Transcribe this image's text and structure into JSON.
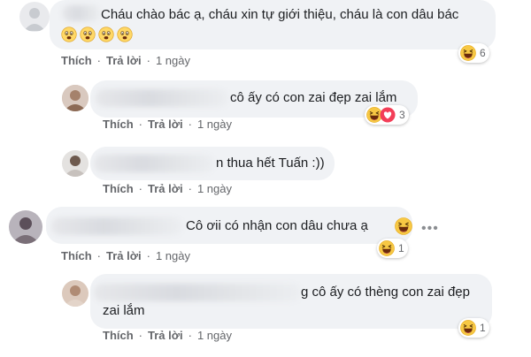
{
  "comments": [
    {
      "text": "Cháu chào bác ạ, cháu xin tự giới thiệu, cháu là con dâu bác",
      "emoji_row": [
        "frowning-face-emoji",
        "frowning-face-emoji",
        "frowning-face-emoji",
        "frowning-face-emoji"
      ],
      "actions": {
        "like": "Thích",
        "reply": "Trả lời",
        "time": "1 ngày"
      },
      "reaction": {
        "icons": [
          "haha-icon"
        ],
        "count": "6"
      }
    },
    {
      "text": "cô ấy có con zai đẹp zai lắm",
      "actions": {
        "like": "Thích",
        "reply": "Trả lời",
        "time": "1 ngày"
      },
      "reaction": {
        "icons": [
          "haha-icon",
          "love-icon"
        ],
        "count": "3"
      }
    },
    {
      "text": "n thua hết Tuấn :))",
      "actions": {
        "like": "Thích",
        "reply": "Trả lời",
        "time": "1 ngày"
      }
    },
    {
      "text": "Cô ơii có nhận con dâu chưa ạ",
      "inline_emoji": "laughing-emoji",
      "more_icon": "more-horizontal-icon",
      "actions": {
        "like": "Thích",
        "reply": "Trả lời",
        "time": "1 ngày"
      },
      "reaction": {
        "icons": [
          "haha-icon"
        ],
        "count": "1"
      }
    },
    {
      "text_line1": "g cô ấy có thèng con zai đẹp",
      "text_line2": "zai lắm",
      "actions": {
        "like": "Thích",
        "reply": "Trả lời",
        "time": "1 ngày"
      },
      "reaction": {
        "icons": [
          "haha-icon"
        ],
        "count": "1"
      }
    }
  ],
  "colors": {
    "bubble": "#f0f2f5",
    "action_text": "#65676b",
    "haha": "#f7b928",
    "love": "#f33e58"
  }
}
